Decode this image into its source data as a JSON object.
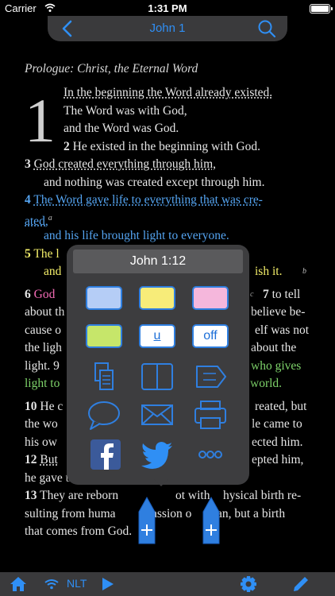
{
  "status": {
    "carrier": "Carrier",
    "time": "1:31 PM"
  },
  "nav": {
    "title": "John 1",
    "back_icon": "chevron-left-icon",
    "search_icon": "search-icon"
  },
  "passage": {
    "heading": "Prologue: Christ, the Eternal Word",
    "chapter": "1",
    "v1_a": "In the beginning the Word already existed.",
    "v1_b": "The Word was with God,",
    "v1_c": "and the Word was God.",
    "v2_num": "2",
    "v2": "He existed in the beginning with God.",
    "v3_num": "3",
    "v3_a": "God created everything through him,",
    "v3_b": "and nothing was created except through him.",
    "v4_num": "4",
    "v4_a": "The Word gave life to everything that was cre-",
    "v4_b": "ated,",
    "v4_fn": "a",
    "v4_c": "and his life brought light to everyone.",
    "v5_num": "5",
    "v5_a": "The l",
    "v5_b": "and",
    "v5_c": "ish it.",
    "v5_fn": "b",
    "v6_num": "6",
    "v6_a": "God",
    "v6_fn": "c",
    "v7_num": "7",
    "v7_a": "to tell",
    "v7_b1": "about th",
    "v7_b2": "believe be-",
    "v7_c1": "cause o",
    "v7_c2": "elf was not",
    "v8_a1": "the ligh",
    "v8_a2": "about the",
    "v8_b1": "light. 9",
    "v8_b2": "who gives",
    "v9_a1": "light to",
    "v9_a2": "world.",
    "v10_num": "10",
    "v10_a1": "He c",
    "v10_a2": "reated, but",
    "v10_b1": "the wo",
    "v10_b2": "le came to",
    "v11_a1": "his ow",
    "v11_a2": "ected him.",
    "v12_num": "12",
    "v12_a1": "But",
    "v12_a2": "epted him,",
    "v12_b": "he gave the right to become children of God.",
    "v13_num": "13",
    "v13_a1": "They are reborn",
    "v13_a2": "ot with",
    "v13_a3": "hysical birth re-",
    "v13_b1": "sulting from huma",
    "v13_b2": "assion o",
    "v13_b3": "an, but a birth",
    "v13_c": "that comes from God."
  },
  "popup": {
    "title": "John 1:12",
    "colors": {
      "blue": "#b5cdf6",
      "yellow": "#f7ec79",
      "pink": "#f5b7dc",
      "green": "#c6e66a",
      "accent": "#2f7fe0"
    },
    "underline_label": "u",
    "off_label": "off",
    "icons": [
      "copy-icon",
      "book-icon",
      "tag-icon",
      "comment-icon",
      "mail-icon",
      "print-icon",
      "facebook-icon",
      "twitter-icon",
      "more-icon"
    ]
  },
  "bottom": {
    "version": "NLT",
    "icons": [
      "home-icon",
      "wifi-icon",
      "play-icon",
      "gear-icon",
      "pencil-icon"
    ]
  }
}
